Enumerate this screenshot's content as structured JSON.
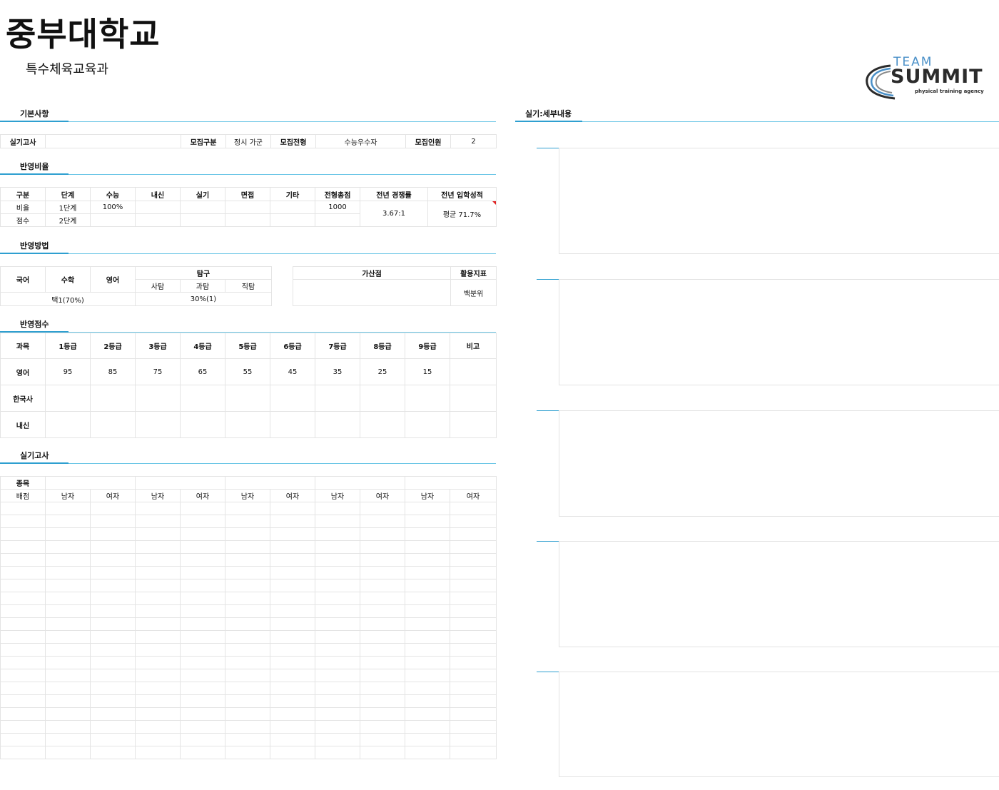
{
  "header": {
    "university": "중부대학교",
    "department": "특수체육교육과"
  },
  "logo": {
    "line1": "TEAM",
    "line2": "SUMMIT",
    "line3": "physical training agency"
  },
  "sections": {
    "basic": "기본사항",
    "ratio": "반영비율",
    "method": "반영방법",
    "score": "반영점수",
    "practical": "실기고사",
    "detail": "실기:세부내용"
  },
  "basic": {
    "practical_label": "실기고사",
    "practical_value": "",
    "type_label": "모집구분",
    "type_value": "정시 가군",
    "track_label": "모집전형",
    "track_value": "수능우수자",
    "count_label": "모집인원",
    "count_value": "2"
  },
  "ratio": {
    "headers": [
      "구분",
      "단계",
      "수능",
      "내신",
      "실기",
      "면접",
      "기타",
      "전형총점",
      "전년 경쟁률",
      "전년 입학성적"
    ],
    "row1": [
      "비율",
      "1단계",
      "100%",
      "",
      "",
      "",
      "",
      "1000"
    ],
    "row2": [
      "점수",
      "2단계",
      "",
      "",
      "",
      "",
      "",
      ""
    ],
    "competition": "3.67:1",
    "admission": "평균 71.7%"
  },
  "method": {
    "korean": "국어",
    "math": "수학",
    "english": "영어",
    "inquiry": "탐구",
    "social": "사탐",
    "science": "과탐",
    "vocational": "직탐",
    "bonus": "가산점",
    "index": "활용지표",
    "combo": "택1(70%)",
    "inquiry_value": "30%(1)",
    "bonus_value": "",
    "index_value": "백분위"
  },
  "score": {
    "headers": [
      "과목",
      "1등급",
      "2등급",
      "3등급",
      "4등급",
      "5등급",
      "6등급",
      "7등급",
      "8등급",
      "9등급",
      "비고"
    ],
    "rows": [
      [
        "영어",
        "95",
        "85",
        "75",
        "65",
        "55",
        "45",
        "35",
        "25",
        "15",
        ""
      ],
      [
        "한국사",
        "",
        "",
        "",
        "",
        "",
        "",
        "",
        "",
        "",
        ""
      ],
      [
        "내신",
        "",
        "",
        "",
        "",
        "",
        "",
        "",
        "",
        "",
        ""
      ]
    ]
  },
  "practical": {
    "event_label": "종목",
    "score_label": "배점",
    "genders": [
      "남자",
      "여자",
      "남자",
      "여자",
      "남자",
      "여자",
      "남자",
      "여자",
      "남자",
      "여자"
    ]
  },
  "colors": {
    "accent": "#2e9fd0",
    "line": "#6cc6e6",
    "grid": "#e4e4e4",
    "logo_dark": "#2b2b2b",
    "logo_blue": "#4a90c8"
  }
}
